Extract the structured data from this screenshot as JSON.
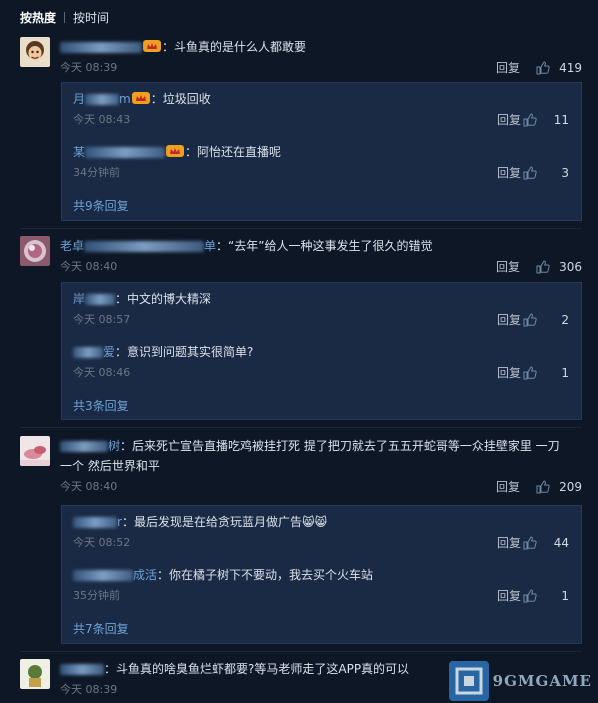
{
  "sort": {
    "hot_label": "按热度",
    "time_label": "按时间"
  },
  "comments": [
    {
      "text": "：斗鱼真的是什么人都敢要",
      "time": "今天 08:39",
      "reply_label": "回复",
      "likes": "419",
      "replies": [
        {
          "name_visible": "月",
          "name_suffix": "m",
          "text": "：垃圾回收",
          "time": "今天 08:43",
          "reply_label": "回复",
          "likes": "11"
        },
        {
          "name_visible": "某",
          "name_suffix": "",
          "text": "：阿怡还在直播呢",
          "time": "34分钟前",
          "reply_label": "回复",
          "likes": "3"
        }
      ],
      "more": "共9条回复"
    },
    {
      "name_visible": "老卓",
      "name_suffix": "单",
      "text": "：“去年”给人一种这事发生了很久的错觉",
      "time": "今天 08:40",
      "reply_label": "回复",
      "likes": "306",
      "replies": [
        {
          "name_visible": "岸",
          "name_suffix": "",
          "text": "：中文的博大精深",
          "time": "今天 08:57",
          "reply_label": "回复",
          "likes": "2"
        },
        {
          "name_visible": "",
          "name_suffix": "爱",
          "text": "：意识到问题其实很简单?",
          "time": "今天 08:46",
          "reply_label": "回复",
          "likes": "1"
        }
      ],
      "more": "共3条回复"
    },
    {
      "name_visible": "",
      "name_suffix": "树",
      "text_line1": "：后来死亡宣告直播吃鸡被挂打死 提了把刀就去了五五开蛇哥等一众挂壁家里 一刀",
      "text_line2": "一个 然后世界和平",
      "time": "今天 08:40",
      "reply_label": "回复",
      "likes": "209",
      "replies": [
        {
          "name_visible": "",
          "name_suffix": "r",
          "text": "：最后发现是在给贪玩蓝月做广告",
          "emoji": "😸😸",
          "time": "今天 08:52",
          "reply_label": "回复",
          "likes": "44"
        },
        {
          "name_visible": "",
          "name_suffix": "成活",
          "text": "：你在橘子树下不要动，我去买个火车站",
          "time": "35分钟前",
          "reply_label": "回复",
          "likes": "1"
        }
      ],
      "more": "共7条回复"
    },
    {
      "name_visible": "",
      "name_suffix": "",
      "text": "：斗鱼真的啥臭鱼烂虾都要?等马老师走了这APP真的可以",
      "time": "今天 08:39"
    }
  ],
  "watermark": {
    "text": "9GMGAME"
  },
  "colors": {
    "background": "#0e1726",
    "reply_box": "#1b2a44",
    "username": "#6ea1d6",
    "muted": "#6b7785"
  }
}
